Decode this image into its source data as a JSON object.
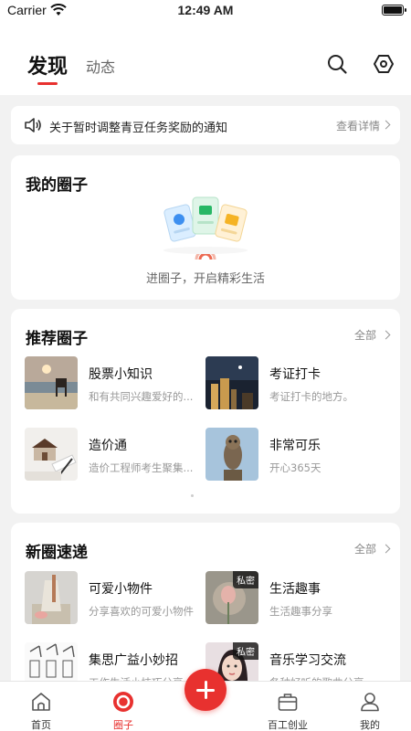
{
  "status_bar": {
    "carrier": "Carrier",
    "time": "12:49 AM"
  },
  "header": {
    "tab_active": "发现",
    "tab_inactive": "动态"
  },
  "notice": {
    "text": "关于暂时调整青豆任务奖励的通知",
    "detail": "查看详情"
  },
  "my_circles": {
    "title": "我的圈子",
    "empty_hint": "进圈子，开启精彩生活"
  },
  "recommended": {
    "title": "推荐圈子",
    "more": "全部",
    "items": [
      {
        "name": "股票小知识",
        "desc": "和有共同兴趣爱好的..."
      },
      {
        "name": "考证打卡",
        "desc": "考证打卡的地方。"
      },
      {
        "name": "造价通",
        "desc": "造价工程师考生聚集..."
      },
      {
        "name": "非常可乐",
        "desc": "开心365天"
      }
    ]
  },
  "new_circles": {
    "title": "新圈速递",
    "more": "全部",
    "private_label": "私密",
    "items": [
      {
        "name": "可爱小物件",
        "desc": "分享喜欢的可爱小物件"
      },
      {
        "name": "生活趣事",
        "desc": "生活趣事分享"
      },
      {
        "name": "集思广益小妙招",
        "desc": "工作生活小技巧分享"
      },
      {
        "name": "音乐学习交流",
        "desc": "各种好听的歌曲分享"
      }
    ]
  },
  "tabbar": {
    "home": "首页",
    "circle": "圈子",
    "business": "百工创业",
    "mine": "我的"
  },
  "colors": {
    "accent": "#e8312f",
    "background": "#f2f2f2"
  }
}
